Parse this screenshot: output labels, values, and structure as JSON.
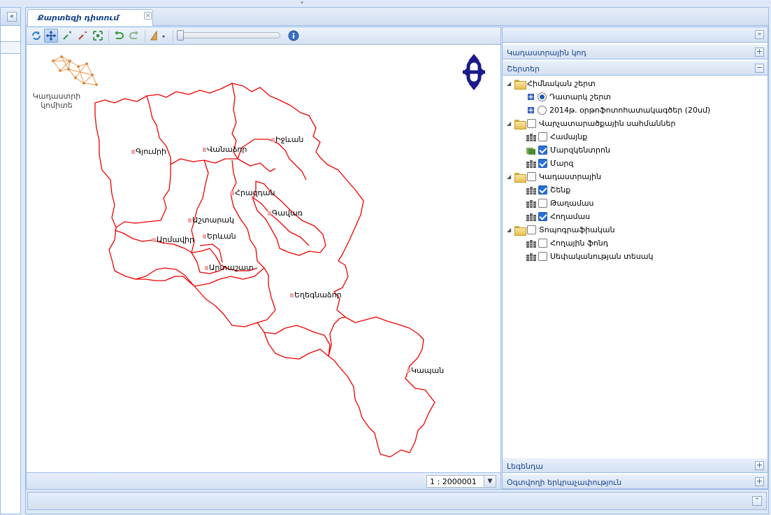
{
  "tab": {
    "title": "Քարտեզի դիտում"
  },
  "layers_panel": {
    "cadastral_code": "Կադաստրային կոդ",
    "layers": "Շերտեր",
    "legend": "Լեգենդա",
    "user_measurement": "Օգտվողի երկրաչափություն"
  },
  "tree": {
    "base": "Հիմնական շերտ",
    "empty": "Դատարկ շերտ",
    "ortho": "2014թ. օրթոֆոտոհատակագծեր (20սմ)",
    "admin": "Վարչատարածքային սահմաններ",
    "community": "Համայնք",
    "marz_center": "Մարզկենտրոն",
    "marz": "Մարզ",
    "cadastral": "Կադաստրային",
    "building": "Շենք",
    "quarter": "Թաղամաս",
    "land": "Հողամաս",
    "topo": "Տոպոգրաֆիական",
    "land_fund": "Հողային ֆոնդ",
    "ownership": "Սեփականության տեսակ"
  },
  "checks": {
    "empty": true,
    "ortho": false,
    "admin": false,
    "community": false,
    "marz_center": true,
    "marz": true,
    "cadastral": false,
    "building": true,
    "quarter": false,
    "land": true,
    "topo": false,
    "land_fund": false,
    "ownership": false
  },
  "scale": {
    "value": "1 : 2000001"
  },
  "logo": {
    "line1": "Կադաստրի",
    "line2": "կոմիտե"
  },
  "map_labels": {
    "gyumri": "Գյումրի",
    "vanadzor": "Վանաձոր",
    "ijevan": "Իջևան",
    "hrazdan": "Հրազդան",
    "gavar": "Գավառ",
    "ashtarak": "Աշտարակ",
    "armavir": "Արմավիր",
    "yerevan": "Երևան",
    "artashat": "Արտաշատ",
    "yeghegnadzor": "Եղեգնաձոր",
    "kapan": "Կապան"
  },
  "colors": {
    "border": "#99bbe8",
    "region": "#ee0000",
    "nav": "#1a1a8c"
  }
}
